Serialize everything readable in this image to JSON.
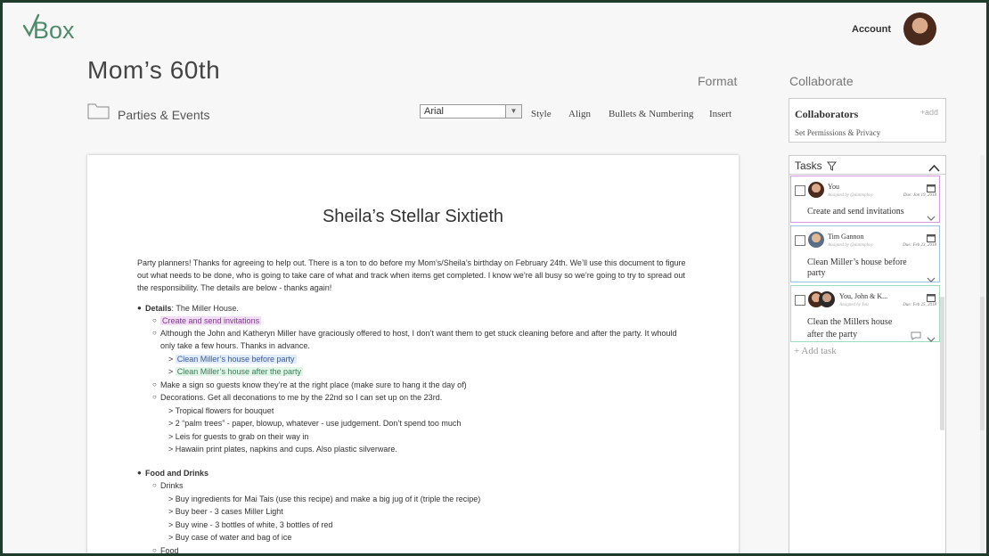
{
  "header": {
    "logo_text": "Box",
    "account_label": "Account",
    "doc_title": "Mom’s 60th",
    "breadcrumb": "Parties & Events",
    "format_tab": "Format",
    "collaborate_tab": "Collaborate"
  },
  "toolbar": {
    "font_value": "Arial",
    "style_label": "Style",
    "align_label": "Align",
    "bullets_label": "Bullets & Numbering",
    "insert_label": "Insert"
  },
  "document": {
    "title": "Sheila’s Stellar Sixtieth",
    "intro": "Party planners! Thanks for agreeing to help out. There is a ton to do before my Mom’s/Sheila’s birthday on February 24th. We’ll use this document to figure out what needs to be done, who is going to take care of what and track when items get completed. I know we’re all busy so we’re going to try to spread out the responsibility. The details are below - thanks again!",
    "details_heading": "Details",
    "details_rest": ": The Miller House.",
    "task_invites": "Create and send invitations",
    "host_line1": "Although the John and Katheryn Miller have graciously offered to host, I don’t want them to get stuck cleaning before and after the party. It whould",
    "host_line2": "only take a few hours. Thanks in advance.",
    "clean_before": "Clean Miller’s house before party",
    "clean_after": "Clean Miller’s house after the party",
    "sign": "Make a sign so guests know they’re at the right place (make sure to hang it the day of)",
    "decorations": "Decorations. Get all deconations to me by the 22nd so I can set up on the 23rd.",
    "deco_items": [
      "> Tropical flowers for bouquet",
      "> 2 “palm trees” - paper, blowup, whatever - use judgement. Don’t spend too much",
      "> Leis for guests to grab on their way in",
      "> Hawaiin print plates, napkins and cups. Also plastic silverware."
    ],
    "food_heading": "Food and Drinks",
    "drinks_label": "Drinks",
    "drink_items": [
      "> Buy ingredients for Mai Tais (use this recipe) and make a big jug of it (triple the recipe)",
      "> Buy beer - 3 cases Miller Light",
      "> Buy wine - 3 bottles of white, 3 bottles of red",
      "> Buy case of water and bag of ice"
    ],
    "food_label": "Food"
  },
  "collaborators": {
    "title": "Collaborators",
    "add_label": "+add",
    "permissions": "Set Permissions & Privacy"
  },
  "tasks": {
    "title": "Tasks",
    "add_task": "Add task",
    "items": [
      {
        "who": "You",
        "assigned": "Assigned by @danmphoy",
        "due": "Due: Jan 19, 2018",
        "text_lines": [
          "Create and send invitations"
        ],
        "border": "#d59be0"
      },
      {
        "who": "Tim Gannon",
        "assigned": "Assigned by @danmphoy",
        "due": "Due: Feb 23, 2018",
        "text_lines": [
          "Clean Miller’s house before",
          "party"
        ],
        "border": "#9bc3e6"
      },
      {
        "who": "You, John & K...",
        "assigned": "Assigned by You",
        "due": "Due: Feb 25, 2018",
        "text_lines": [
          "Clean the Millers house",
          "after the party"
        ],
        "border": "#9fdcc0"
      }
    ]
  },
  "colors": {
    "brand": "#2f5d4a",
    "frame": "#1f3b2c"
  }
}
